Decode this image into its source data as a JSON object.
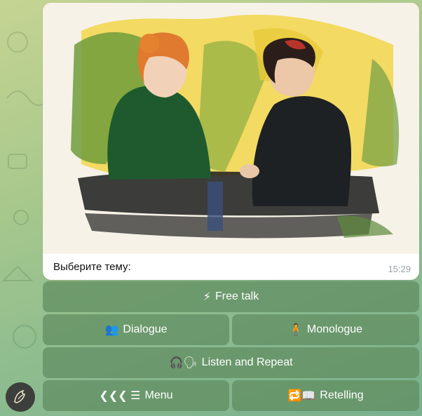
{
  "message": {
    "caption": "Выберите тему:",
    "time": "15:29"
  },
  "keyboard": {
    "free_talk": {
      "icon": "⚡",
      "label": "Free talk"
    },
    "dialogue": {
      "icon": "👥",
      "label": "Dialogue"
    },
    "monologue": {
      "icon": "🧍",
      "label": "Monologue"
    },
    "listen_repeat": {
      "icon": "🎧🗣",
      "label": "Listen and Repeat"
    },
    "menu": {
      "icon": "❮❮❮ ☰",
      "label": "Menu"
    },
    "retelling": {
      "icon": "🔁📖",
      "label": "Retelling"
    }
  },
  "colors": {
    "button_bg": "#5f8c5f",
    "bubble_bg": "#ffffff",
    "time_text": "#9aa3a8"
  }
}
